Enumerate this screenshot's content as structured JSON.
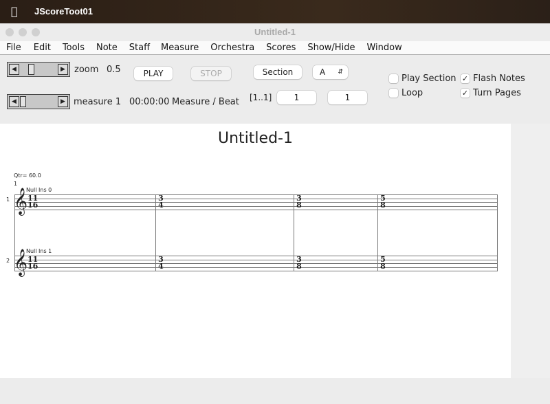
{
  "system": {
    "app_name": "JScoreToot01",
    "apple_icon": "apple-logo-icon"
  },
  "window": {
    "title": "Untitled-1"
  },
  "menu": [
    "File",
    "Edit",
    "Tools",
    "Note",
    "Staff",
    "Measure",
    "Orchestra",
    "Scores",
    "Show/Hide",
    "Window"
  ],
  "toolbar": {
    "zoom_label": "zoom",
    "zoom_value": "0.5",
    "zoom_slider_fraction": 0.2,
    "measure_label": "measure 1",
    "measure_slider_fraction": 0.05,
    "play": "PLAY",
    "stop": "STOP",
    "time": "00:00:00",
    "measure_beat": "Measure / Beat",
    "section_button": "Section",
    "section_select": "A",
    "range": "[1..1]",
    "field1": "1",
    "field2": "1",
    "play_section": {
      "label": "Play Section",
      "checked": false
    },
    "loop": {
      "label": "Loop",
      "checked": false
    },
    "flash_notes": {
      "label": "Flash Notes",
      "checked": true
    },
    "turn_pages": {
      "label": "Turn Pages",
      "checked": true
    }
  },
  "score": {
    "title": "Untitled-1",
    "tempo": "Qtr= 60.0",
    "measure_number": "1",
    "staves": [
      {
        "number": "1",
        "instrument": "Null Ins 0"
      },
      {
        "number": "2",
        "instrument": "Null Ins 1"
      }
    ],
    "time_signatures": [
      [
        "11",
        "16"
      ],
      [
        "3",
        "4"
      ],
      [
        "3",
        "8"
      ],
      [
        "5",
        "8"
      ]
    ]
  }
}
